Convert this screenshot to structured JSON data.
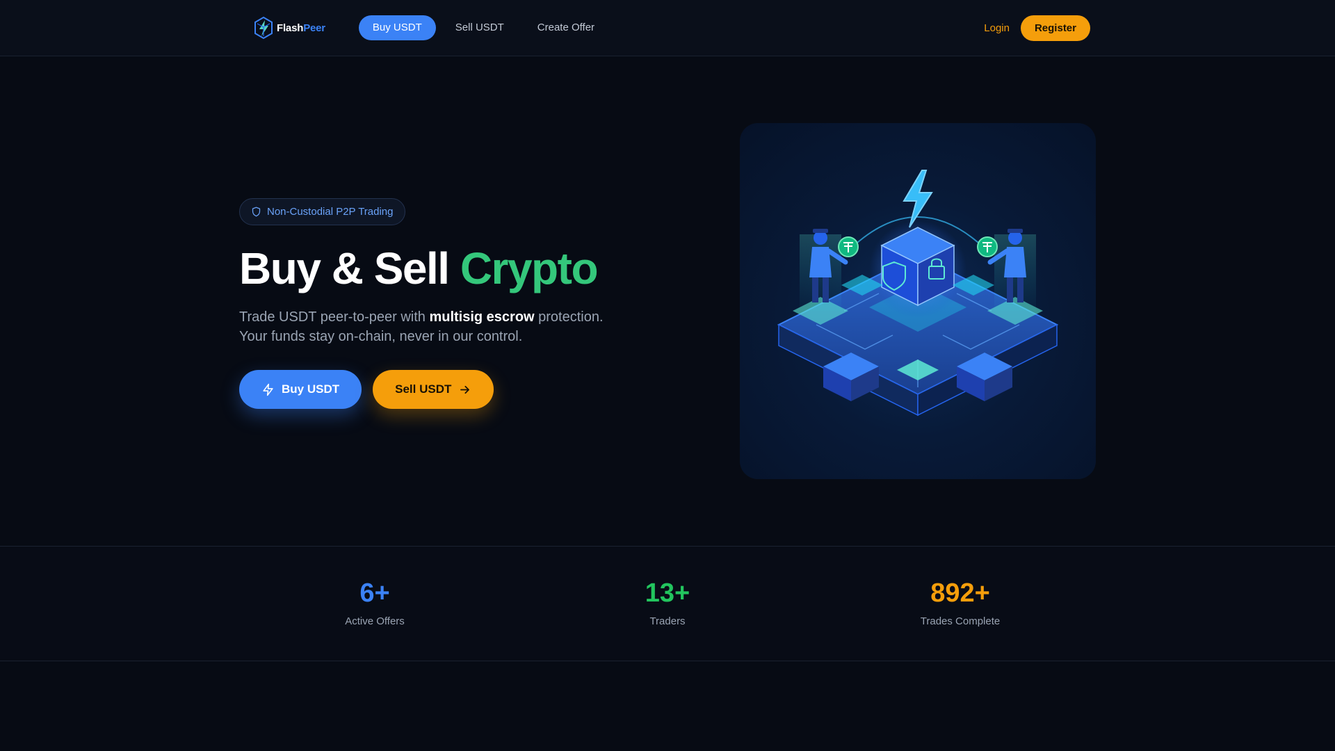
{
  "brand": {
    "name_part1": "Flash",
    "name_part2": "Peer"
  },
  "nav": {
    "items": [
      {
        "label": "Buy USDT",
        "active": true
      },
      {
        "label": "Sell USDT",
        "active": false
      },
      {
        "label": "Create Offer",
        "active": false
      }
    ]
  },
  "auth": {
    "login_label": "Login",
    "register_label": "Register"
  },
  "hero": {
    "badge": "Non-Custodial P2P Trading",
    "title_main": "Buy & Sell ",
    "title_accent": "Crypto",
    "subtitle_part1": "Trade USDT peer-to-peer with ",
    "subtitle_strong": "multisig escrow",
    "subtitle_part2": " protection.",
    "subtitle_line2": "Your funds stay on-chain, never in our control.",
    "buy_button": "Buy USDT",
    "sell_button": "Sell USDT"
  },
  "stats": [
    {
      "value": "6+",
      "label": "Active Offers",
      "color": "#3b82f6"
    },
    {
      "value": "13+",
      "label": "Traders",
      "color": "#22c55e"
    },
    {
      "value": "892+",
      "label": "Trades Complete",
      "color": "#f59e0b"
    }
  ],
  "icons": {
    "logo": "flashpeer-logo-icon",
    "badge": "shield-icon",
    "buy": "lightning-icon",
    "sell": "arrow-right-icon"
  },
  "colors": {
    "primary": "#3b82f6",
    "accent_green": "#34c77b",
    "accent_orange": "#f59e0b",
    "background": "#070b14"
  }
}
